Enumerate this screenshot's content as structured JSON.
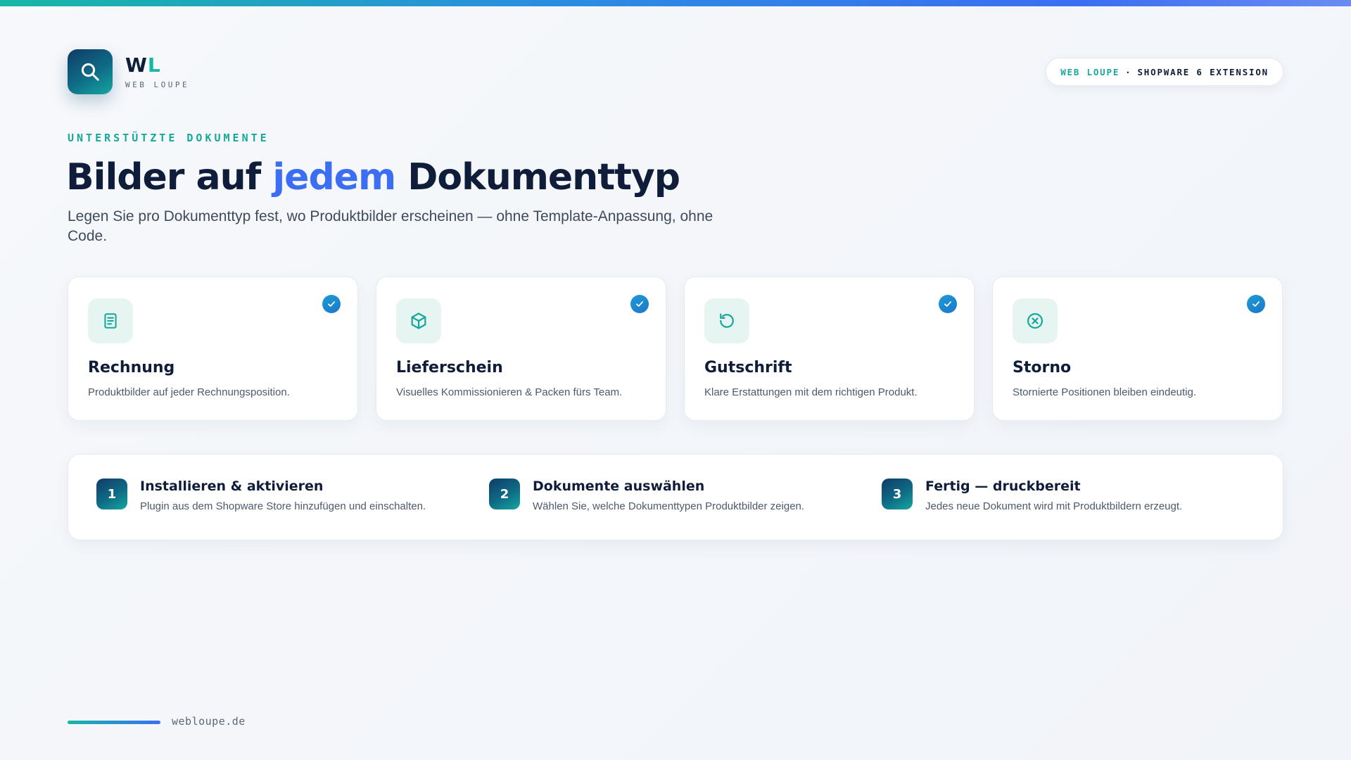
{
  "brand": {
    "logo_mark_w": "W",
    "logo_mark_l": "L",
    "logo_sub": "WEB LOUPE",
    "badge_a": "WEB LOUPE",
    "badge_sep": "·",
    "badge_b": "SHOPWARE 6 EXTENSION"
  },
  "hero": {
    "eyebrow": "UNTERSTÜTZTE DOKUMENTE",
    "title_pre": "Bilder auf ",
    "title_highlight": "jedem",
    "title_post": " Dokumenttyp",
    "subtitle": "Legen Sie pro Dokumenttyp fest, wo Produktbilder erscheinen — ohne Template-Anpassung, ohne Code."
  },
  "cards": [
    {
      "icon": "document-icon",
      "title": "Rechnung",
      "desc": "Produktbilder auf jeder Rechnungsposition."
    },
    {
      "icon": "box-icon",
      "title": "Lieferschein",
      "desc": "Visuelles Kommissionieren & Packen fürs Team."
    },
    {
      "icon": "refresh-icon",
      "title": "Gutschrift",
      "desc": "Klare Erstattungen mit dem richtigen Produkt."
    },
    {
      "icon": "cancel-circle-icon",
      "title": "Storno",
      "desc": "Stornierte Positionen bleiben eindeutig."
    }
  ],
  "steps": [
    {
      "num": "1",
      "title": "Installieren & aktivieren",
      "desc": "Plugin aus dem Shopware Store hinzufügen und einschalten."
    },
    {
      "num": "2",
      "title": "Dokumente auswählen",
      "desc": "Wählen Sie, welche Dokumenttypen Produktbilder zeigen."
    },
    {
      "num": "3",
      "title": "Fertig — druckbereit",
      "desc": "Jedes neue Dokument wird mit Produktbildern erzeugt."
    }
  ],
  "footer": {
    "url": "webloupe.de"
  },
  "colors": {
    "accent_teal": "#17b7a6",
    "accent_blue": "#3b6ef2",
    "text_dark": "#0f1d3a",
    "check_blue": "#1f9bd6"
  }
}
